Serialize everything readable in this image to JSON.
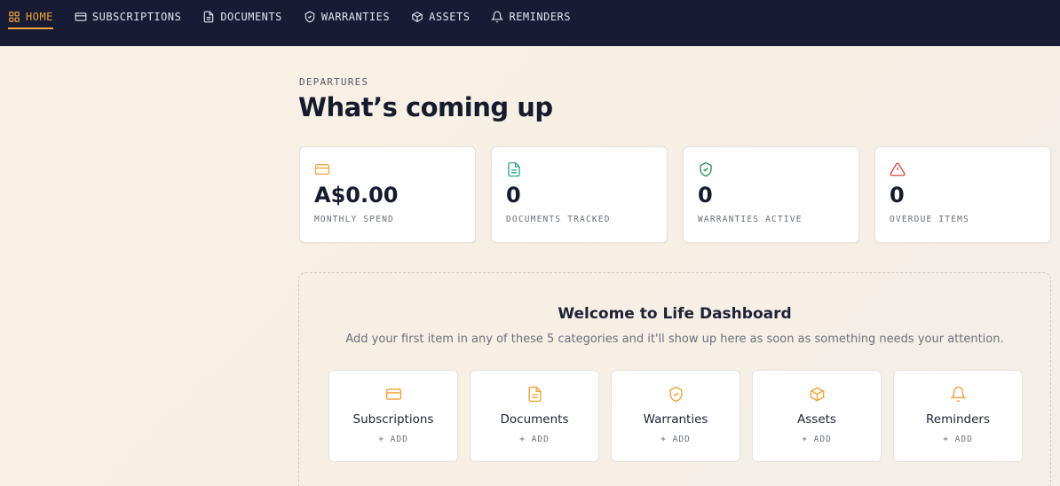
{
  "nav": {
    "items": [
      {
        "label": "HOME",
        "icon": "grid-icon",
        "active": true
      },
      {
        "label": "SUBSCRIPTIONS",
        "icon": "credit-card-icon",
        "active": false
      },
      {
        "label": "DOCUMENTS",
        "icon": "document-icon",
        "active": false
      },
      {
        "label": "WARRANTIES",
        "icon": "shield-check-icon",
        "active": false
      },
      {
        "label": "ASSETS",
        "icon": "box-icon",
        "active": false
      },
      {
        "label": "REMINDERS",
        "icon": "bell-icon",
        "active": false
      }
    ]
  },
  "header": {
    "eyebrow": "DEPARTURES",
    "title": "What’s coming up"
  },
  "stats": [
    {
      "icon": "credit-card-icon",
      "color": "#f2a33a",
      "value": "A$0.00",
      "label": "MONTHLY SPEND"
    },
    {
      "icon": "document-icon",
      "color": "#2fa58a",
      "value": "0",
      "label": "DOCUMENTS TRACKED"
    },
    {
      "icon": "shield-check-icon",
      "color": "#2f8f5b",
      "value": "0",
      "label": "WARRANTIES ACTIVE"
    },
    {
      "icon": "alert-triangle-icon",
      "color": "#e0473a",
      "value": "0",
      "label": "OVERDUE ITEMS"
    }
  ],
  "welcome": {
    "title": "Welcome to Life Dashboard",
    "subtitle": "Add your first item in any of these 5 categories and it'll show up here as soon as something needs your attention.",
    "categories": [
      {
        "name": "Subscriptions",
        "icon": "credit-card-icon",
        "add": "+ ADD"
      },
      {
        "name": "Documents",
        "icon": "document-icon",
        "add": "+ ADD"
      },
      {
        "name": "Warranties",
        "icon": "shield-check-icon",
        "add": "+ ADD"
      },
      {
        "name": "Assets",
        "icon": "box-icon",
        "add": "+ ADD"
      },
      {
        "name": "Reminders",
        "icon": "bell-icon",
        "add": "+ ADD"
      }
    ]
  },
  "colors": {
    "accent": "#f2a33a",
    "nav_bg": "#171b33",
    "nav_text": "#e3e5ef"
  }
}
